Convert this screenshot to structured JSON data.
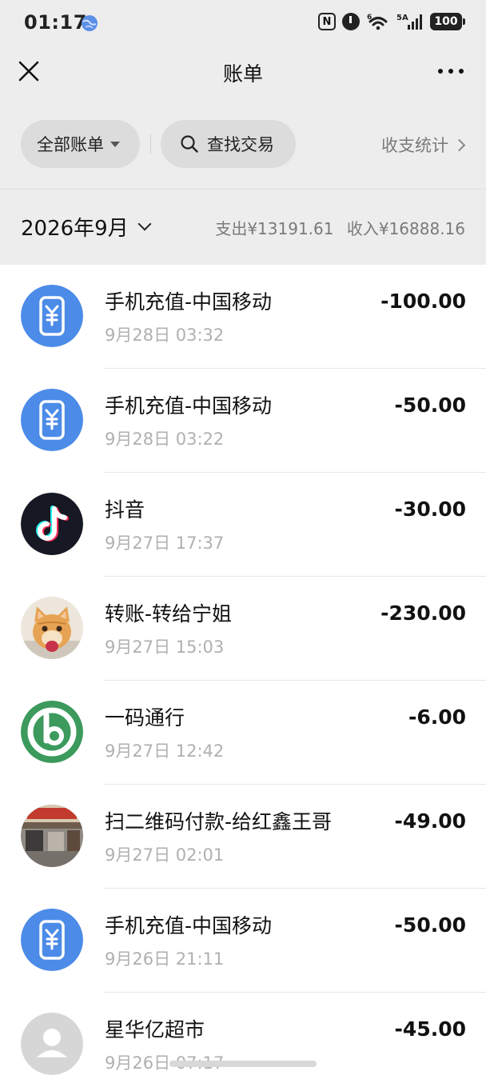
{
  "status_bar": {
    "time": "01:17",
    "nfc_label": "N",
    "network": "5A",
    "signal_sub": "6",
    "battery": "100"
  },
  "header": {
    "title": "账单"
  },
  "filters": {
    "all_bills": "全部账单",
    "search": "查找交易",
    "stats": "收支统计"
  },
  "month_summary": {
    "month": "2026年9月",
    "expense": "支出¥13191.61",
    "income": "收入¥16888.16"
  },
  "colors": {
    "phone_blue": "#4c8be8",
    "douyin_black": "#161823",
    "yima_green": "#3b9a5c"
  },
  "transactions": [
    {
      "title": "手机充值-中国移动",
      "date": "9月28日 03:32",
      "amount": "-100.00",
      "icon": "phone-recharge-icon"
    },
    {
      "title": "手机充值-中国移动",
      "date": "9月28日 03:22",
      "amount": "-50.00",
      "icon": "phone-recharge-icon"
    },
    {
      "title": "抖音",
      "date": "9月27日 17:37",
      "amount": "-30.00",
      "icon": "douyin-icon"
    },
    {
      "title": "转账-转给宁姐",
      "date": "9月27日 15:03",
      "amount": "-230.00",
      "icon": "cat-avatar"
    },
    {
      "title": "一码通行",
      "date": "9月27日 12:42",
      "amount": "-6.00",
      "icon": "yima-logo-icon"
    },
    {
      "title": "扫二维码付款-给红鑫王哥",
      "date": "9月27日 02:01",
      "amount": "-49.00",
      "icon": "shop-photo-avatar"
    },
    {
      "title": "手机充值-中国移动",
      "date": "9月26日 21:11",
      "amount": "-50.00",
      "icon": "phone-recharge-icon"
    },
    {
      "title": "星华亿超市",
      "date": "9月26日 07:17",
      "amount": "-45.00",
      "icon": "default-user-icon"
    }
  ]
}
